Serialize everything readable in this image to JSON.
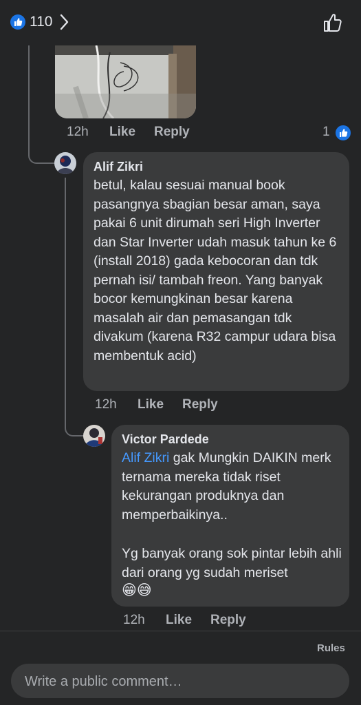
{
  "header": {
    "like_count": "110",
    "icons": {
      "reactions": "like-reaction-icon",
      "next": "chevron-right-icon",
      "like_action": "thumbs-up-outline-icon"
    }
  },
  "first_comment": {
    "time": "12h",
    "like_label": "Like",
    "reply_label": "Reply",
    "reaction_count": "1"
  },
  "replies": [
    {
      "author": "Alif Zikri",
      "text": "betul, kalau sesuai manual book pasangnya sbagian besar aman, saya pakai 6 unit dirumah seri High Inverter dan Star Inverter udah masuk tahun ke 6 (install 2018) gada kebocoran dan tdk pernah isi/ tambah freon. Yang banyak bocor kemungkinan besar karena masalah air dan pemasangan tdk divakum (karena R32 campur udara bisa membentuk acid)",
      "time": "12h",
      "like_label": "Like",
      "reply_label": "Reply"
    },
    {
      "author": "Victor Pardede",
      "mention": "Alif Zikri",
      "text_after_mention": " gak Mungkin DAIKIN merk ternama mereka tidak riset kekurangan produknya dan memperbaikinya..",
      "text_second": "Yg banyak orang sok pintar lebih ahli dari orang yg sudah meriset",
      "emoji": "😁😅",
      "time": "12h",
      "like_label": "Like",
      "reply_label": "Reply"
    }
  ],
  "footer": {
    "rules_label": "Rules",
    "comment_placeholder": "Write a public comment…"
  },
  "colors": {
    "background": "#242526",
    "bubble": "#3a3b3c",
    "accent": "#1b74e4",
    "mention": "#4599ff",
    "secondary_text": "#b0b3b8"
  }
}
